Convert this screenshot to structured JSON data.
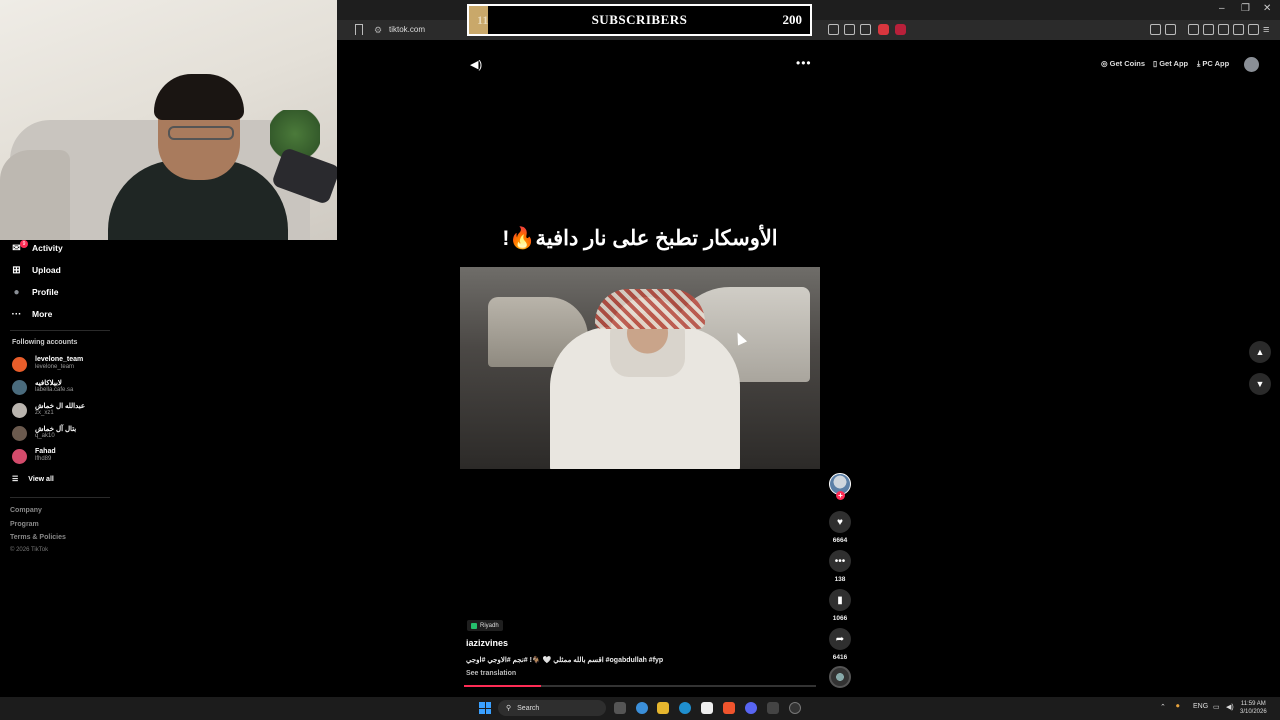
{
  "browser": {
    "url": "tiktok.com",
    "window_controls": [
      "–",
      "❐",
      "✕"
    ]
  },
  "overlay": {
    "label": "SUBSCRIBERS",
    "current": "11",
    "goal": "200",
    "progress": 0.055
  },
  "header": {
    "get_coins": "Get Coins",
    "get_app": "Get App",
    "pc_app": "PC App"
  },
  "sidebar": {
    "items": [
      {
        "label": "Activity",
        "icon": "activity-icon",
        "glyph": "✉"
      },
      {
        "label": "Upload",
        "icon": "upload-icon",
        "glyph": "⊞"
      },
      {
        "label": "Profile",
        "icon": "profile-icon",
        "glyph": "●"
      },
      {
        "label": "More",
        "icon": "more-icon",
        "glyph": "···"
      }
    ],
    "activity_badge": "9",
    "following_header": "Following accounts",
    "accounts": [
      {
        "name": "levelone_team",
        "handle": "levelone_team",
        "color": "#e85d2a"
      },
      {
        "name": "لابيلاكافيه",
        "handle": "labella.cafe.sa",
        "color": "#4a6b7d"
      },
      {
        "name": "عبدالله ال خماش",
        "handle": "zx_xz1",
        "color": "#b9b4ae"
      },
      {
        "name": "بتال آل خماش",
        "handle": "q_ak10",
        "color": "#6b5a4e"
      },
      {
        "name": "Fahad",
        "handle": "lfhd89",
        "color": "#d34b6b"
      }
    ],
    "view_all": "View all",
    "footer": [
      "Company",
      "Program",
      "Terms & Policies"
    ],
    "copyright": "© 2026 TikTok"
  },
  "video": {
    "caption": "الأوسكار تطبخ على نار دافية🔥!",
    "location": "Riyadh",
    "author": "iazizvines",
    "description": "اقسم بالله ممثلي 🤍 🐐! #نجم #الاوجي #اوجي #ogabdullah #fyp",
    "see_translation": "See translation",
    "progress": 0.22
  },
  "actions": {
    "likes": "6664",
    "comments": "138",
    "saves": "1066",
    "shares": "6416"
  },
  "taskbar": {
    "search": "Search",
    "lang": "ENG",
    "time": "11:59 AM",
    "date": "3/10/2026"
  }
}
